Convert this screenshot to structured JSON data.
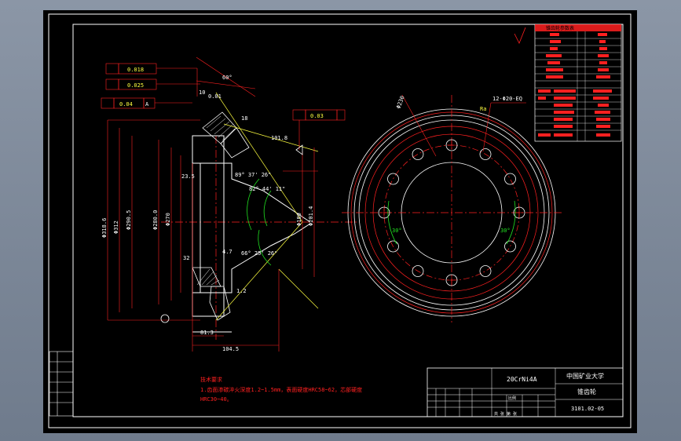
{
  "drawing": {
    "tolerances": {
      "runout_total": "0.018",
      "runout_circ": "0.025",
      "concentricity": "0.04",
      "datum": "A",
      "flatness_right": "0.03"
    },
    "section_dims": {
      "d_outer_tip": "Φ318.6",
      "d_312": "Φ312",
      "d_290_5": "Φ290.5",
      "d_280": "Φ280.0",
      "d_270": "Φ270",
      "d_bore_main": "Φ180",
      "d_bore_right": "Φ201.4",
      "angle_top": "89° 37' 26\"",
      "angle_mid": "82° 44' 11\"",
      "angle_low": "66° 25' 26\"",
      "len_23_5": "23.5",
      "len_81_3": "81.3",
      "len_104_5": "104.5",
      "tooth_18": "18",
      "tooth_10": "10",
      "cone_101": "101.8",
      "angle_60": "60°",
      "chamfer": "0.01",
      "small_12": "1.2",
      "small_47": "4.7",
      "small_32": "32"
    },
    "front_view": {
      "hole_callout": "12-Φ20-EQ",
      "pitch_label": "Φ230",
      "deg_30_left": "30°",
      "deg_30_right": "30°",
      "surface_label": "Ra"
    },
    "notes": {
      "title": "技术要求",
      "line1": "1.齿面渗碳淬火深度1.2~1.5mm，表面硬度HRC58~62，芯部硬度",
      "line2": "HRC30~40。"
    },
    "title_block": {
      "material": "20CrNi4A",
      "school": "中国矿业大学",
      "part_name": "锥齿轮",
      "drawing_no": "3101.02-05",
      "scale_label": "比例",
      "sheet_label": "共 张 第 张"
    },
    "param_table": {
      "header": "锥齿轮参数表"
    }
  }
}
